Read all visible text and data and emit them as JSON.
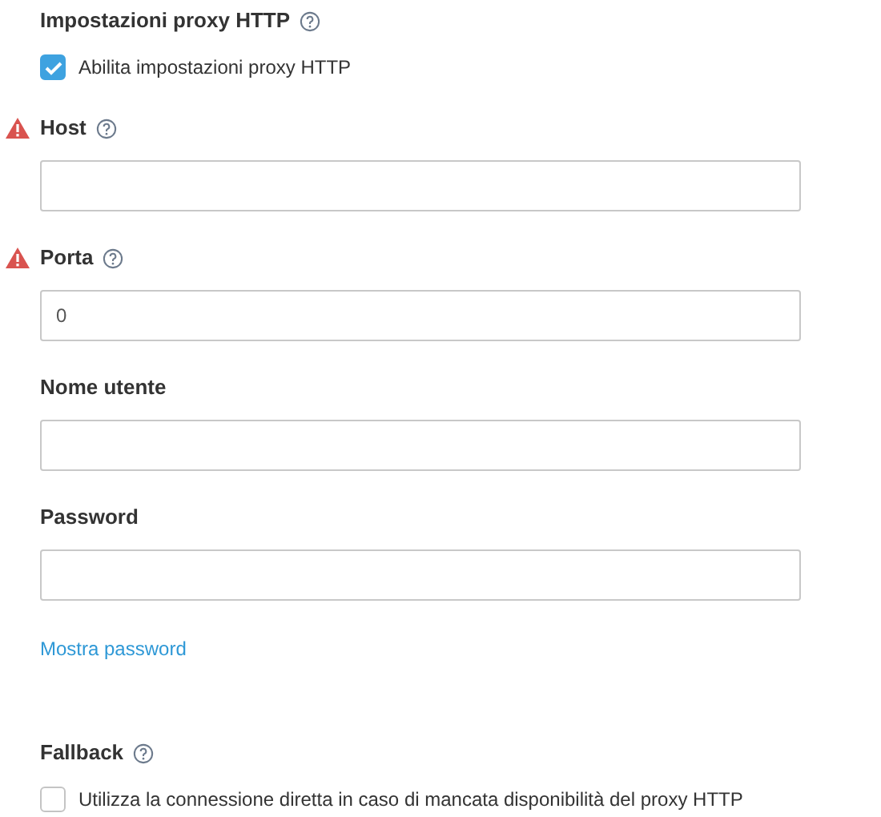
{
  "proxy_section": {
    "title": "Impostazioni proxy HTTP",
    "help": true,
    "enable": {
      "label": "Abilita impostazioni proxy HTTP",
      "checked": true
    }
  },
  "fields": [
    {
      "label": "Host",
      "help": true,
      "warning": true
    },
    {
      "label": "Porta",
      "help": true,
      "warning": true,
      "value": "0"
    },
    {
      "label": "Nome utente",
      "help": false,
      "warning": false
    },
    {
      "label": "Password",
      "help": false,
      "warning": false
    }
  ],
  "show_password_link": "Mostra password",
  "fallback_section": {
    "title": "Fallback",
    "help": true,
    "option": {
      "label": "Utilizza la connessione diretta in caso di mancata disponibilità del proxy HTTP",
      "checked": false
    }
  }
}
